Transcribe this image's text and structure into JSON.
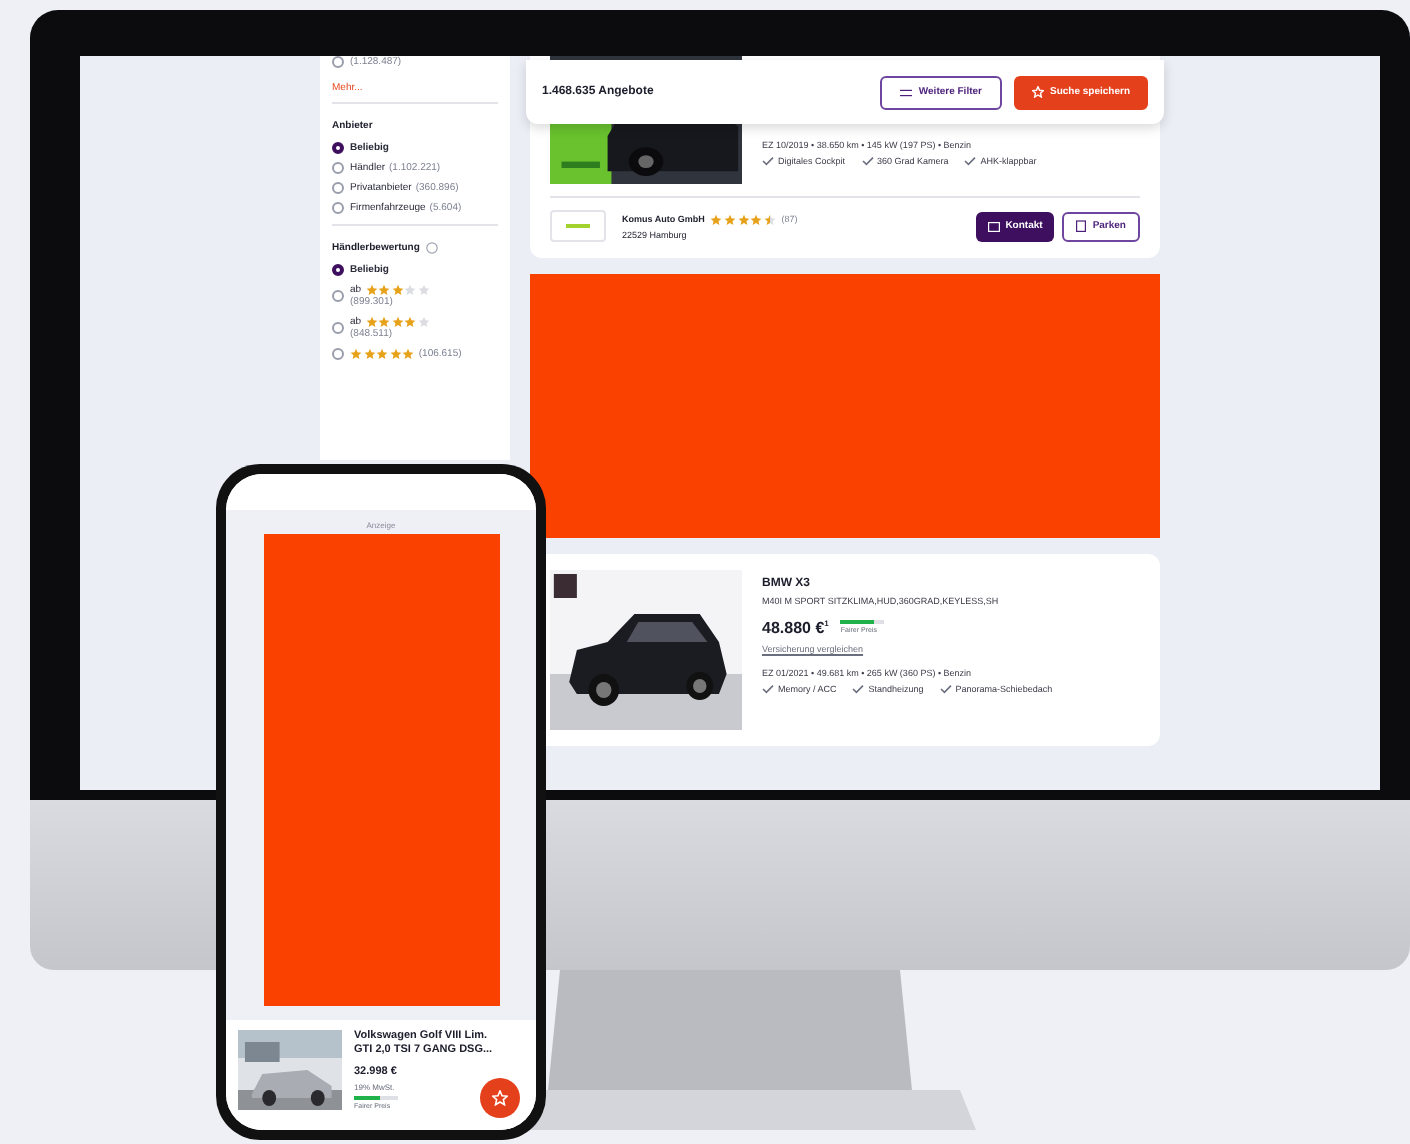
{
  "monitor": {
    "sidebar": {
      "top_option": {
        "count": "(1.128.487)",
        "selected": false
      },
      "more_link": "Mehr...",
      "groups": [
        {
          "title": "Anbieter",
          "info": false,
          "options": [
            {
              "label": "Beliebig",
              "selected": true
            },
            {
              "label": "Händler",
              "count": "(1.102.221)",
              "selected": false
            },
            {
              "label": "Privatanbieter",
              "count": "(360.896)",
              "selected": false
            },
            {
              "label": "Firmenfahrzeuge",
              "count": "(5.604)",
              "selected": false
            }
          ]
        },
        {
          "title": "Händlerbewertung",
          "info": true,
          "options": [
            {
              "label": "Beliebig",
              "selected": true
            },
            {
              "prefix": "ab",
              "stars": 3,
              "count": "(899.301)",
              "selected": false
            },
            {
              "prefix": "ab",
              "stars": 4,
              "count": "(848.511)",
              "selected": false
            },
            {
              "stars": 5,
              "count": "(106.615)",
              "selected": false
            }
          ]
        }
      ]
    },
    "toolbar": {
      "count": "1.468.635 Angebote",
      "buttons": [
        {
          "label": "Weitere Filter",
          "kind": "outline"
        },
        {
          "label": "Suche speichern",
          "kind": "primary"
        }
      ]
    },
    "listings": [
      {
        "kind": "listing",
        "details": "EZ 10/2019 • 38.650 km • 145 kW (197 PS) • Benzin",
        "features": [
          "Digitales Cockpit",
          "360 Grad Kamera",
          "AHK-klappbar"
        ],
        "dealer": {
          "name": "Komus Auto GmbH",
          "stars": 4.5,
          "reviews": "(87)",
          "location": "22529 Hamburg"
        },
        "actions": [
          {
            "label": "Kontakt",
            "kind": "primary"
          },
          {
            "label": "Parken",
            "kind": "outline"
          }
        ]
      },
      {
        "kind": "ad"
      },
      {
        "kind": "listing",
        "title": "BMW X3",
        "subtitle": "M40I M SPORT SITZKLIMA,HUD,360GRAD,KEYLESS,SH",
        "price": "48.880 €$^{1}$",
        "price_rating": {
          "level": 0.75,
          "label": "Fairer Preis"
        },
        "link": "Versicherung vergleichen",
        "details": "EZ 01/2021 • 49.681 km • 265 kW (360 PS) • Benzin",
        "features": [
          "Memory / ACC",
          "Standheizung",
          "Panorama-Schiebedach"
        ]
      }
    ]
  },
  "phone": {
    "ad_label": "Anzeige",
    "listing": {
      "title": "Volkswagen Golf VIII Lim. GTI 2,0 TSI 7 GANG DSG...",
      "price": "32.998 €",
      "vat": "19% MwSt.",
      "price_rating": {
        "level": 0.6,
        "label": "Fairer Preis"
      }
    }
  }
}
